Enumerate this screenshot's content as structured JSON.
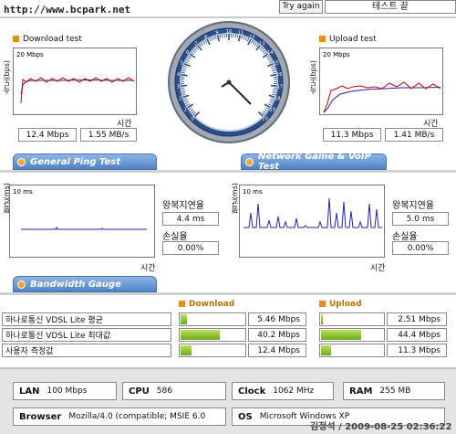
{
  "header": {
    "watermark": "http://www.bcpark.net",
    "try_again": "Try again",
    "status": "테스트 끝"
  },
  "download": {
    "title": "Download test",
    "scale": "20 Mbps",
    "axis_y": "속도(bps)",
    "axis_x": "시간",
    "mbps": "12.4 Mbps",
    "mbs": "1.55 MB/s"
  },
  "upload": {
    "title": "Upload test",
    "scale": "20 Mbps",
    "axis_y": "속도(bps)",
    "axis_x": "시간",
    "mbps": "11.3 Mbps",
    "mbs": "1.41 MB/s"
  },
  "speedometer": {
    "ticks": [
      "0",
      "1",
      "2",
      "3",
      "4",
      "5",
      "6",
      "7",
      "8",
      "9",
      "10",
      "11",
      "12",
      "13",
      "14",
      "15",
      "16",
      "17",
      "18",
      "19",
      "20"
    ]
  },
  "sections": {
    "ping_title": "General Ping Test",
    "game_title": "Network Game & VoIP Test",
    "gauge_title": "Bandwidth Gauge"
  },
  "ping": {
    "scale": "10 ms",
    "axis_y": "평균(ms)",
    "axis_x": "시간",
    "rtt_label": "왕복지연율",
    "rtt": "4.4 ms",
    "loss_label": "손실율",
    "loss": "0.00%"
  },
  "game": {
    "scale": "10 ms",
    "axis_y": "평균(ms)",
    "axis_x": "시간",
    "rtt_label": "왕복지연율",
    "rtt": "5.0 ms",
    "loss_label": "손실율",
    "loss": "0.00%"
  },
  "bandwidth": {
    "download_label": "Download",
    "upload_label": "Upload",
    "rows": [
      {
        "label": "하나로통신 VDSL Lite 평균",
        "down": "5.46 Mbps",
        "down_frac": 0.12,
        "up": "2.51 Mbps",
        "up_frac": 0.06
      },
      {
        "label": "하나로통신 VDSL Lite 최대값",
        "down": "40.2 Mbps",
        "down_frac": 0.62,
        "up": "44.4 Mbps",
        "up_frac": 0.65
      },
      {
        "label": "사용자 측정값",
        "down": "12.4 Mbps",
        "down_frac": 0.2,
        "up": "11.3 Mbps",
        "up_frac": 0.18
      }
    ]
  },
  "system": {
    "lan_label": "LAN",
    "lan": "100 Mbps",
    "cpu_label": "CPU",
    "cpu": "586",
    "clock_label": "Clock",
    "clock": "1062 MHz",
    "ram_label": "RAM",
    "ram": "255 MB",
    "browser_label": "Browser",
    "browser": "Mozilla/4.0 (compatible; MSIE 6.0",
    "os_label": "OS",
    "os": "Microsoft Windows XP"
  },
  "footer": {
    "stamp": "김정석 / 2009-08-25 02:36:22"
  },
  "colors": {
    "accent_blue": "#4d82c6",
    "orange": "#f08c00",
    "download_line": "#cc0000",
    "series_blue": "#2222aa",
    "gauge_green": "#6aa820"
  }
}
